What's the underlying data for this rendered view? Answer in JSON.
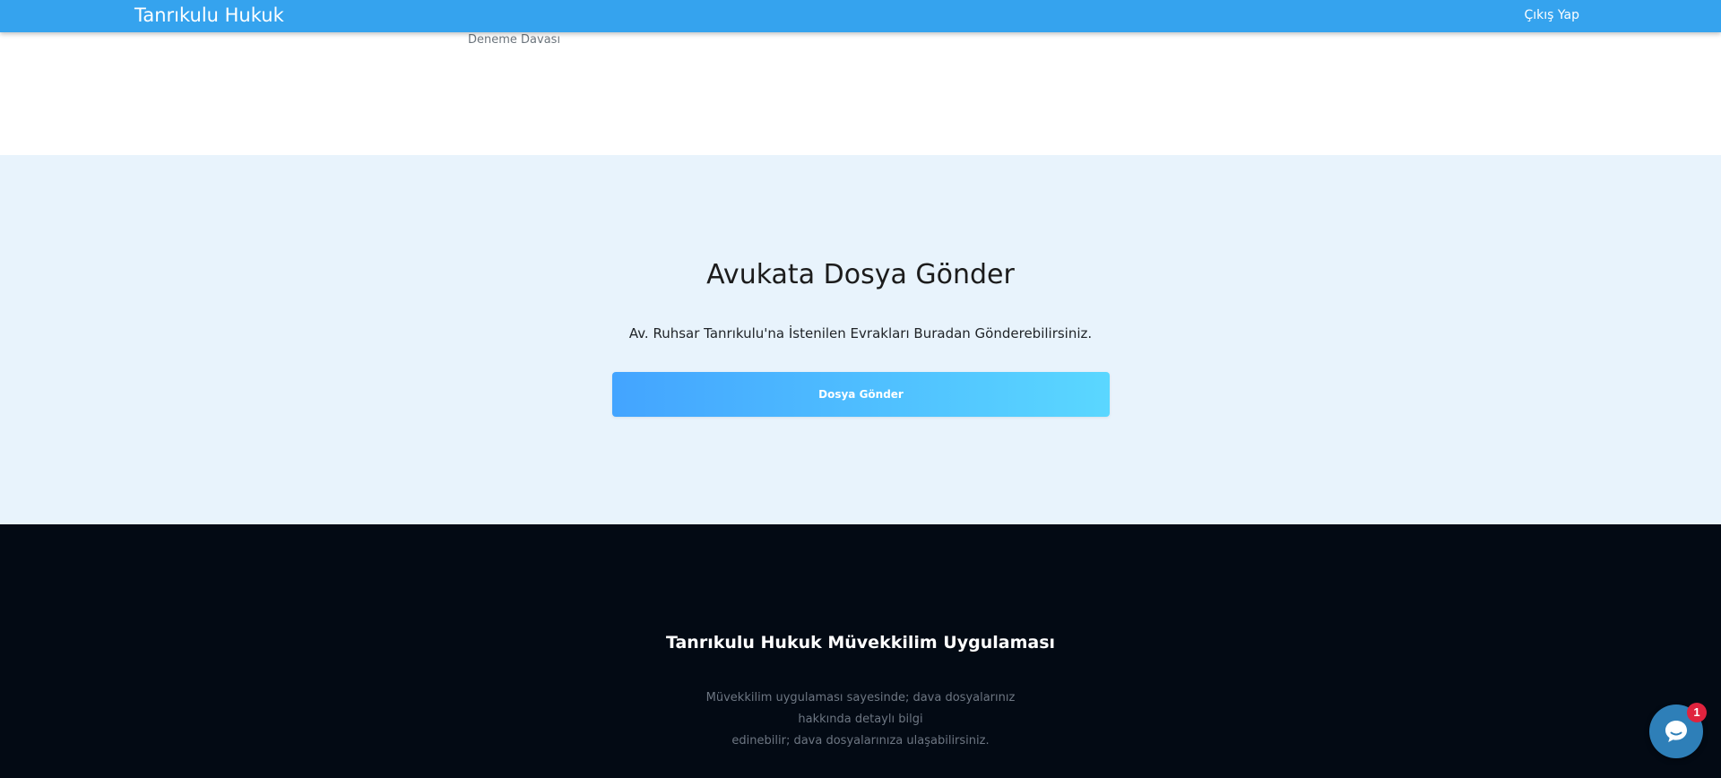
{
  "navbar": {
    "brand": "Tanrıkulu Hukuk",
    "logout_label": "Çıkış Yap",
    "color": "#35a3ee"
  },
  "cases": {
    "visible_item": "Deneme Davası"
  },
  "send_section": {
    "title": "Avukata Dosya Gönder",
    "description": "Av. Ruhsar Tanrıkulu'na İstenilen Evrakları Buradan Gönderebilirsiniz.",
    "button_label": "Dosya Gönder",
    "background": "#e8f3fc",
    "button_gradient": [
      "#43a4ff",
      "#5ad7ff"
    ]
  },
  "footer": {
    "title": "Tanrıkulu Hukuk Müvekkilim Uygulaması",
    "description_line1": "Müvekkilim uygulaması sayesinde; dava dosyalarınız hakkında detaylı bilgi",
    "description_line2": "edinebilir; dava dosyalarınıza ulaşabilirsiniz.",
    "background": "#030a14"
  },
  "chat": {
    "icon": "chat-bubble-icon",
    "badge_count": "1"
  }
}
